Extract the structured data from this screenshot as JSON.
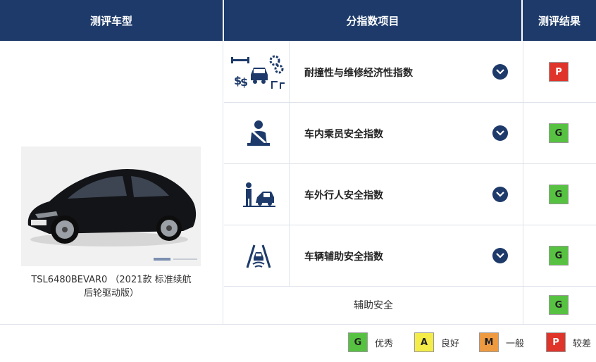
{
  "header": {
    "col_model": "测评车型",
    "col_items": "分指数项目",
    "col_result": "测评结果"
  },
  "car": {
    "caption_line1": "TSL6480BEVAR0 （2021款 标准续航",
    "caption_line2": "后轮驱动版）"
  },
  "rows": [
    {
      "label": "耐撞性与维修经济性指数",
      "icon": "crash-repair-icon",
      "result": "P"
    },
    {
      "label": "车内乘员安全指数",
      "icon": "seatbelt-occupant-icon",
      "result": "G"
    },
    {
      "label": "车外行人安全指数",
      "icon": "pedestrian-icon",
      "result": "G"
    },
    {
      "label": "车辆辅助安全指数",
      "icon": "lane-assist-icon",
      "result": "G"
    }
  ],
  "aux": {
    "label": "辅助安全",
    "result": "G"
  },
  "legend": [
    {
      "code": "G",
      "text": "优秀"
    },
    {
      "code": "A",
      "text": "良好"
    },
    {
      "code": "M",
      "text": "一般"
    },
    {
      "code": "P",
      "text": "较差"
    }
  ],
  "colors": {
    "header_bg": "#1d3a6a",
    "good": "#57c241",
    "acceptable": "#f4ec48",
    "marginal": "#ee9a40",
    "poor": "#e0342a"
  }
}
